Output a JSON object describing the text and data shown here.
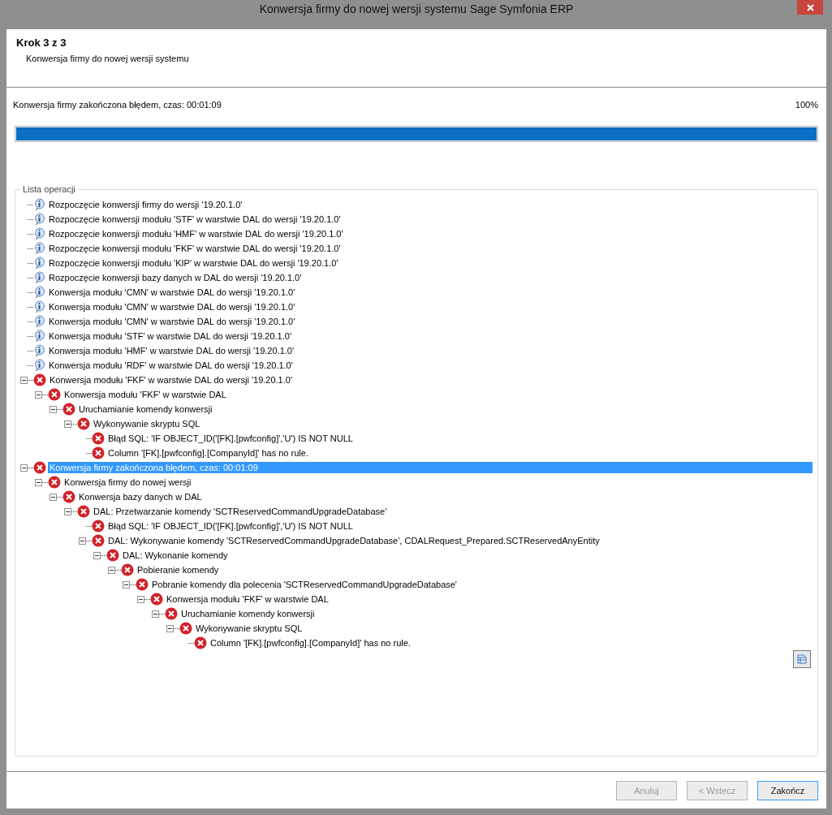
{
  "window": {
    "title": "Konwersja firmy do nowej wersji systemu Sage Symfonia ERP"
  },
  "header": {
    "step": "Krok 3 z 3",
    "subtitle": "Konwersja firmy do nowej wersji systemu"
  },
  "progress": {
    "status": "Konwersja firmy zakończona błędem, czas: 00:01:09",
    "percent": "100%",
    "level": 1
  },
  "operations": {
    "title": "Lista operacji",
    "items": [
      {
        "kind": "info",
        "text": "Rozpoczęcie konwersji firmy do wersji '19.20.1.0'",
        "selected": false
      },
      {
        "kind": "info",
        "text": "Rozpoczęcie konwersji modułu 'STF' w warstwie DAL do wersji '19.20.1.0'",
        "selected": false
      },
      {
        "kind": "info",
        "text": "Rozpoczęcie konwersji modułu 'HMF' w warstwie DAL do wersji '19.20.1.0'",
        "selected": false
      },
      {
        "kind": "info",
        "text": "Rozpoczęcie konwersji modułu 'FKF' w warstwie DAL do wersji '19.20.1.0'",
        "selected": false
      },
      {
        "kind": "info",
        "text": "Rozpoczęcie konwersji modułu 'KIP' w warstwie DAL do wersji '19.20.1.0'",
        "selected": false
      },
      {
        "kind": "info",
        "text": "Rozpoczęcie konwersji bazy danych w DAL do wersji '19.20.1.0'",
        "selected": false
      },
      {
        "kind": "info",
        "text": "Konwersja modułu 'CMN' w warstwie DAL do wersji '19.20.1.0'",
        "selected": false
      },
      {
        "kind": "info",
        "text": "Konwersja modułu 'CMN' w warstwie DAL do wersji '19.20.1.0'",
        "selected": false
      },
      {
        "kind": "info",
        "text": "Konwersja modułu 'CMN' w warstwie DAL do wersji '19.20.1.0'",
        "selected": false
      },
      {
        "kind": "info",
        "text": "Konwersja modułu 'STF' w warstwie DAL do wersji '19.20.1.0'",
        "selected": false
      },
      {
        "kind": "info",
        "text": "Konwersja modułu 'HMF' w warstwie DAL do wersji '19.20.1.0'",
        "selected": false
      },
      {
        "kind": "info",
        "text": "Konwersja modułu 'RDF' w warstwie DAL do wersji '19.20.1.0'",
        "selected": false
      },
      {
        "kind": "error",
        "text": "Konwersja modułu 'FKF' w warstwie DAL do wersji '19.20.1.0'",
        "selected": false,
        "expanded": true,
        "children": [
          {
            "kind": "error",
            "text": "Konwersja modułu 'FKF' w warstwie DAL",
            "selected": false,
            "expanded": true,
            "children": [
              {
                "kind": "error",
                "text": "Uruchamianie komendy konwersji",
                "selected": false,
                "expanded": true,
                "children": [
                  {
                    "kind": "error",
                    "text": "Wykonywanie skryptu SQL",
                    "selected": false,
                    "expanded": true,
                    "children": [
                      {
                        "kind": "error",
                        "text": "Błąd SQL: 'IF OBJECT_ID('[FK].[pwfconfig]','U') IS NOT NULL",
                        "selected": false
                      },
                      {
                        "kind": "error",
                        "text": "Column '[FK].[pwfconfig].[CompanyId]' has no rule.",
                        "selected": false
                      }
                    ]
                  }
                ]
              }
            ]
          }
        ]
      },
      {
        "kind": "error",
        "text": "Konwersja firmy zakończona błędem, czas: 00:01:09",
        "selected": true,
        "expanded": true,
        "children": [
          {
            "kind": "error",
            "text": "Konwersja firmy do nowej wersji",
            "selected": false,
            "expanded": true,
            "children": [
              {
                "kind": "error",
                "text": "Konwersja bazy danych w DAL",
                "selected": false,
                "expanded": true,
                "children": [
                  {
                    "kind": "error",
                    "text": "DAL: Przetwarzanie komendy 'SCTReservedCommandUpgradeDatabase'",
                    "selected": false,
                    "expanded": true,
                    "children": [
                      {
                        "kind": "error",
                        "text": "Błąd SQL: 'IF OBJECT_ID('[FK].[pwfconfig]','U') IS NOT NULL",
                        "selected": false
                      },
                      {
                        "kind": "error",
                        "text": "DAL: Wykonywanie komendy 'SCTReservedCommandUpgradeDatabase', CDALRequest_Prepared.SCTReservedAnyEntity",
                        "selected": false,
                        "expanded": true,
                        "children": [
                          {
                            "kind": "error",
                            "text": "DAL: Wykonanie komendy",
                            "selected": false,
                            "expanded": true,
                            "children": [
                              {
                                "kind": "error",
                                "text": "Pobieranie komendy",
                                "selected": false,
                                "expanded": true,
                                "children": [
                                  {
                                    "kind": "error",
                                    "text": "Pobranie komendy dla polecenia 'SCTReservedCommandUpgradeDatabase'",
                                    "selected": false,
                                    "expanded": true,
                                    "children": [
                                      {
                                        "kind": "error",
                                        "text": "Konwersja modułu 'FKF' w warstwie DAL",
                                        "selected": false,
                                        "expanded": true,
                                        "children": [
                                          {
                                            "kind": "error",
                                            "text": "Uruchamianie komendy konwersji",
                                            "selected": false,
                                            "expanded": true,
                                            "children": [
                                              {
                                                "kind": "error",
                                                "text": "Wykonywanie skryptu SQL",
                                                "selected": false,
                                                "expanded": true,
                                                "children": [
                                                  {
                                                    "kind": "error",
                                                    "text": "Column '[FK].[pwfconfig].[CompanyId]' has no rule.",
                                                    "selected": false
                                                  }
                                                ]
                                              }
                                            ]
                                          }
                                        ]
                                      }
                                    ]
                                  }
                                ]
                              }
                            ]
                          }
                        ]
                      }
                    ]
                  }
                ]
              }
            ]
          }
        ]
      }
    ]
  },
  "buttons": [
    {
      "label": "Anuluj",
      "disabled": true,
      "default": false
    },
    {
      "label": "< Wstecz",
      "disabled": true,
      "default": false
    },
    {
      "label": "Zakończ",
      "disabled": false,
      "default": true
    }
  ]
}
